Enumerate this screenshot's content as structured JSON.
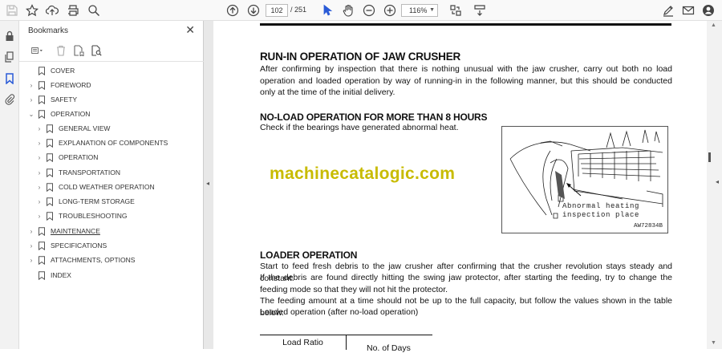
{
  "toolbar": {
    "page_current": "102",
    "page_total": "/ 251",
    "zoom": "116%"
  },
  "bookmarks_panel": {
    "title": "Bookmarks",
    "close": "✕",
    "items": [
      {
        "label": "COVER",
        "chev": ""
      },
      {
        "label": "FOREWORD",
        "chev": "›"
      },
      {
        "label": "SAFETY",
        "chev": "›"
      },
      {
        "label": "OPERATION",
        "chev": "⌄"
      },
      {
        "label": "GENERAL VIEW",
        "chev": "›"
      },
      {
        "label": "EXPLANATION OF COMPONENTS",
        "chev": "›"
      },
      {
        "label": "OPERATION",
        "chev": "›"
      },
      {
        "label": "TRANSPORTATION",
        "chev": "›"
      },
      {
        "label": "COLD WEATHER OPERATION",
        "chev": "›"
      },
      {
        "label": "LONG-TERM STORAGE",
        "chev": "›"
      },
      {
        "label": "TROUBLESHOOTING",
        "chev": "›"
      },
      {
        "label": "MAINTENANCE",
        "chev": "›"
      },
      {
        "label": "SPECIFICATIONS",
        "chev": "›"
      },
      {
        "label": "ATTACHMENTS, OPTIONS",
        "chev": "›"
      },
      {
        "label": "INDEX",
        "chev": ""
      }
    ]
  },
  "document": {
    "heading1": "RUN-IN OPERATION OF JAW CRUSHER",
    "para1": "After confirming by inspection that there is nothing unusual with the jaw crusher, carry out both no load operation and loaded operation by way of running-in in the following manner, but this should be conducted only at the time of the initial delivery.",
    "heading2": "NO-LOAD OPERATION FOR MORE THAN 8 HOURS",
    "para2": "Check if the bearings have generated abnormal heat.",
    "watermark": "machinecatalogic.com",
    "figure_label_1": "Abnormal heating",
    "figure_label_2": "inspection place",
    "figure_code": "AW72834B",
    "heading3": "LOADER OPERATION",
    "para3": "Start to feed fresh debris to the jaw crusher after confirming that the crusher revolution stays steady and constant.",
    "para4": "If the debris are found directly hitting the swing jaw protector, after starting the feeding, try to change the feeding mode so that they will not hit the protector.",
    "para5": "The feeding amount at a time should not be up to the full capacity, but follow the values shown in the table below.",
    "para6": "Loaded operation (after no-load operation)",
    "table_header_1": "Load Ratio",
    "table_header_2": "No. of Days"
  }
}
